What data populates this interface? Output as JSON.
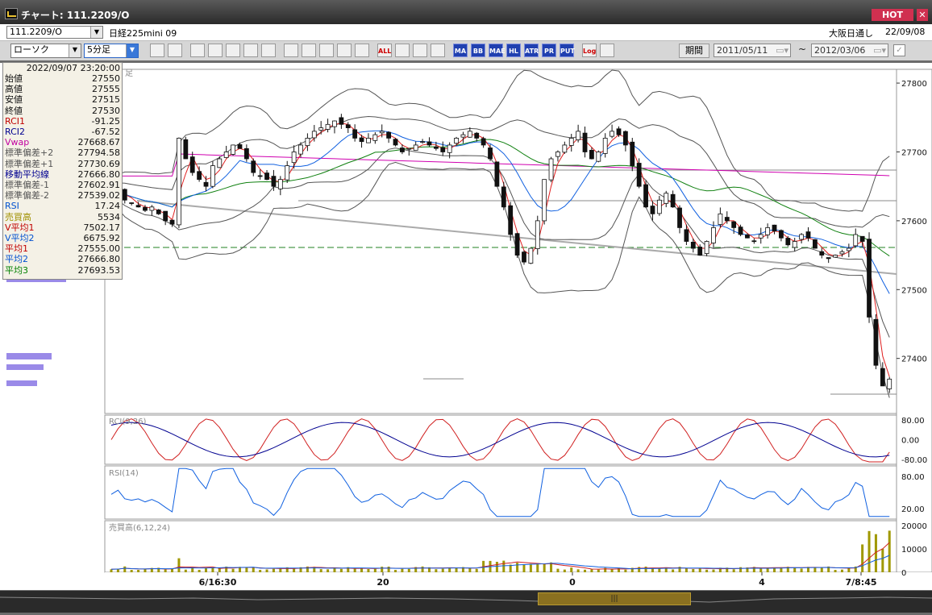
{
  "window": {
    "title": "チャート: 111.2209/O",
    "hot_label": "HOT",
    "close_label": "✕"
  },
  "toolbar1": {
    "symbol_value": "111.2209/O",
    "symbol_name": "日経225mini 09",
    "session": "大阪日通し",
    "date": "22/09/08"
  },
  "toolbar2": {
    "chart_type": "ローソク",
    "interval": "5分足",
    "buttons": [
      "search",
      "layout",
      "tb3",
      "zoom",
      "chart4",
      "chart5",
      "pen",
      "chart7",
      "cursor",
      "reset",
      "chart10",
      "chart11",
      "ALL",
      "settings",
      "wrench",
      "color",
      "MA",
      "BB",
      "MAE",
      "HL",
      "ATR",
      "PR",
      "PUT",
      "Log",
      "export"
    ],
    "period_label": "期間",
    "date_from": "2011/05/11",
    "date_to": "2012/03/06",
    "tilde": "~"
  },
  "info": {
    "timestamp": "2022/09/07  23:20:00",
    "rows": [
      {
        "label": "始値",
        "value": "27550",
        "color": "#111111"
      },
      {
        "label": "高値",
        "value": "27555",
        "color": "#111111"
      },
      {
        "label": "安値",
        "value": "27515",
        "color": "#111111"
      },
      {
        "label": "終値",
        "value": "27530",
        "color": "#111111"
      },
      {
        "label": "RCI1",
        "value": "-91.25",
        "color": "#c00000"
      },
      {
        "label": "RCI2",
        "value": "-67.52",
        "color": "#000090"
      },
      {
        "label": "Vwap",
        "value": "27668.67",
        "color": "#c000a0"
      },
      {
        "label": "標準偏差+2",
        "value": "27794.58",
        "color": "#555555"
      },
      {
        "label": "標準偏差+1",
        "value": "27730.69",
        "color": "#555555"
      },
      {
        "label": "移動平均線",
        "value": "27666.80",
        "color": "#000090"
      },
      {
        "label": "標準偏差-1",
        "value": "27602.91",
        "color": "#555555"
      },
      {
        "label": "標準偏差-2",
        "value": "27539.02",
        "color": "#555555"
      },
      {
        "label": "RSI",
        "value": "17.24",
        "color": "#0050d0"
      },
      {
        "label": "売買高",
        "value": "5534",
        "color": "#a09000"
      },
      {
        "label": "V平均1",
        "value": "7502.17",
        "color": "#c00000"
      },
      {
        "label": "V平均2",
        "value": "6675.92",
        "color": "#0050d0"
      },
      {
        "label": "平均1",
        "value": "27555.00",
        "color": "#c00000"
      },
      {
        "label": "平均2",
        "value": "27666.80",
        "color": "#0050d0"
      },
      {
        "label": "平均3",
        "value": "27693.53",
        "color": "#008000"
      }
    ]
  },
  "main_panel": {
    "label": "足",
    "yticks": [
      "27800",
      "27700",
      "27600",
      "27500",
      "27400"
    ]
  },
  "rci_panel": {
    "label": "RCI(9,26)",
    "yticks": [
      "80.00",
      "0.00",
      "-80.00"
    ]
  },
  "rsi_panel": {
    "label": "RSI(14)",
    "yticks": [
      "80.00",
      "20.00"
    ]
  },
  "vol_panel": {
    "label": "売買高(6,12,24)",
    "yticks": [
      "20000",
      "10000",
      "0"
    ]
  },
  "xaxis": {
    "ticks": [
      "6/16:30",
      "20",
      "0",
      "4",
      "7/8:45"
    ]
  },
  "colors": {
    "up": "#ffffff",
    "down": "#111111",
    "ma1": "#e02020",
    "ma2": "#1060e0",
    "ma3": "#108010",
    "vwap": "#d000b0",
    "band": "#555555",
    "vol": "#a09800"
  },
  "chart_data": {
    "type": "candlestick",
    "ylim": [
      27320,
      27820
    ],
    "interval": "5分足",
    "x_ticks": [
      "6/16:30",
      "20",
      "0",
      "4",
      "7/8:45"
    ],
    "closes": [
      27640,
      27645,
      27630,
      27625,
      27620,
      27615,
      27620,
      27610,
      27600,
      27595,
      27720,
      27690,
      27670,
      27660,
      27650,
      27680,
      27690,
      27700,
      27710,
      27705,
      27690,
      27670,
      27665,
      27660,
      27650,
      27660,
      27680,
      27700,
      27710,
      27720,
      27730,
      27735,
      27740,
      27745,
      27740,
      27735,
      27720,
      27715,
      27720,
      27725,
      27730,
      27720,
      27710,
      27700,
      27705,
      27710,
      27715,
      27710,
      27705,
      27700,
      27710,
      27720,
      27725,
      27730,
      27720,
      27710,
      27690,
      27650,
      27620,
      27580,
      27550,
      27540,
      27560,
      27600,
      27660,
      27690,
      27700,
      27710,
      27720,
      27730,
      27700,
      27690,
      27700,
      27720,
      27730,
      27725,
      27710,
      27680,
      27650,
      27620,
      27610,
      27630,
      27640,
      27620,
      27590,
      27570,
      27560,
      27550,
      27570,
      27590,
      27610,
      27600,
      27590,
      27580,
      27575,
      27570,
      27580,
      27590,
      27585,
      27575,
      27565,
      27570,
      27580,
      27575,
      27560,
      27550,
      27545,
      27550,
      27555,
      27560,
      27580,
      27570,
      27460,
      27390,
      27360,
      27370
    ],
    "volume_max": 20000
  }
}
